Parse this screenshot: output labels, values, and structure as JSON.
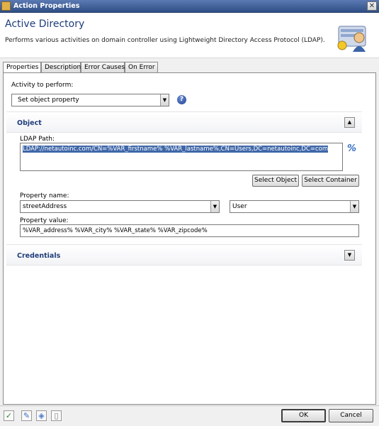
{
  "window": {
    "title": "Action Properties",
    "close_glyph": "✕"
  },
  "header": {
    "title": "Active Directory",
    "description": "Performs various activities on domain controller using Lightweight Directory Access Protocol (LDAP)."
  },
  "tabs": [
    {
      "label": "Properties",
      "active": true
    },
    {
      "label": "Description",
      "active": false
    },
    {
      "label": "Error Causes",
      "active": false
    },
    {
      "label": "On Error",
      "active": false
    }
  ],
  "activity": {
    "label": "Activity to perform:",
    "value": "Set object property",
    "help_glyph": "?"
  },
  "object_section": {
    "title": "Object",
    "ldap_label": "LDAP Path:",
    "ldap_value": "LDAP://netautoinc.com/CN=%VAR_firstname% %VAR_lastname%,CN=Users,DC=netautoinc,DC=com",
    "select_object_label": "Select Object",
    "select_container_label": "Select Container",
    "property_name_label": "Property name:",
    "property_name_value": "streetAddress",
    "property_class_value": "User",
    "property_value_label": "Property value:",
    "property_value": "%VAR_address% %VAR_city% %VAR_state% %VAR_zipcode%",
    "ldap_icon_glyph": "%"
  },
  "credentials_section": {
    "title": "Credentials"
  },
  "footer": {
    "ok_label": "OK",
    "cancel_label": "Cancel",
    "icons": [
      "check-icon",
      "edit-icon",
      "shield-edit-icon",
      "blank-doc-icon"
    ]
  },
  "colors": {
    "accent": "#1f3d7a",
    "titlebar": "#3a5a96",
    "selection": "#3f67a8"
  }
}
